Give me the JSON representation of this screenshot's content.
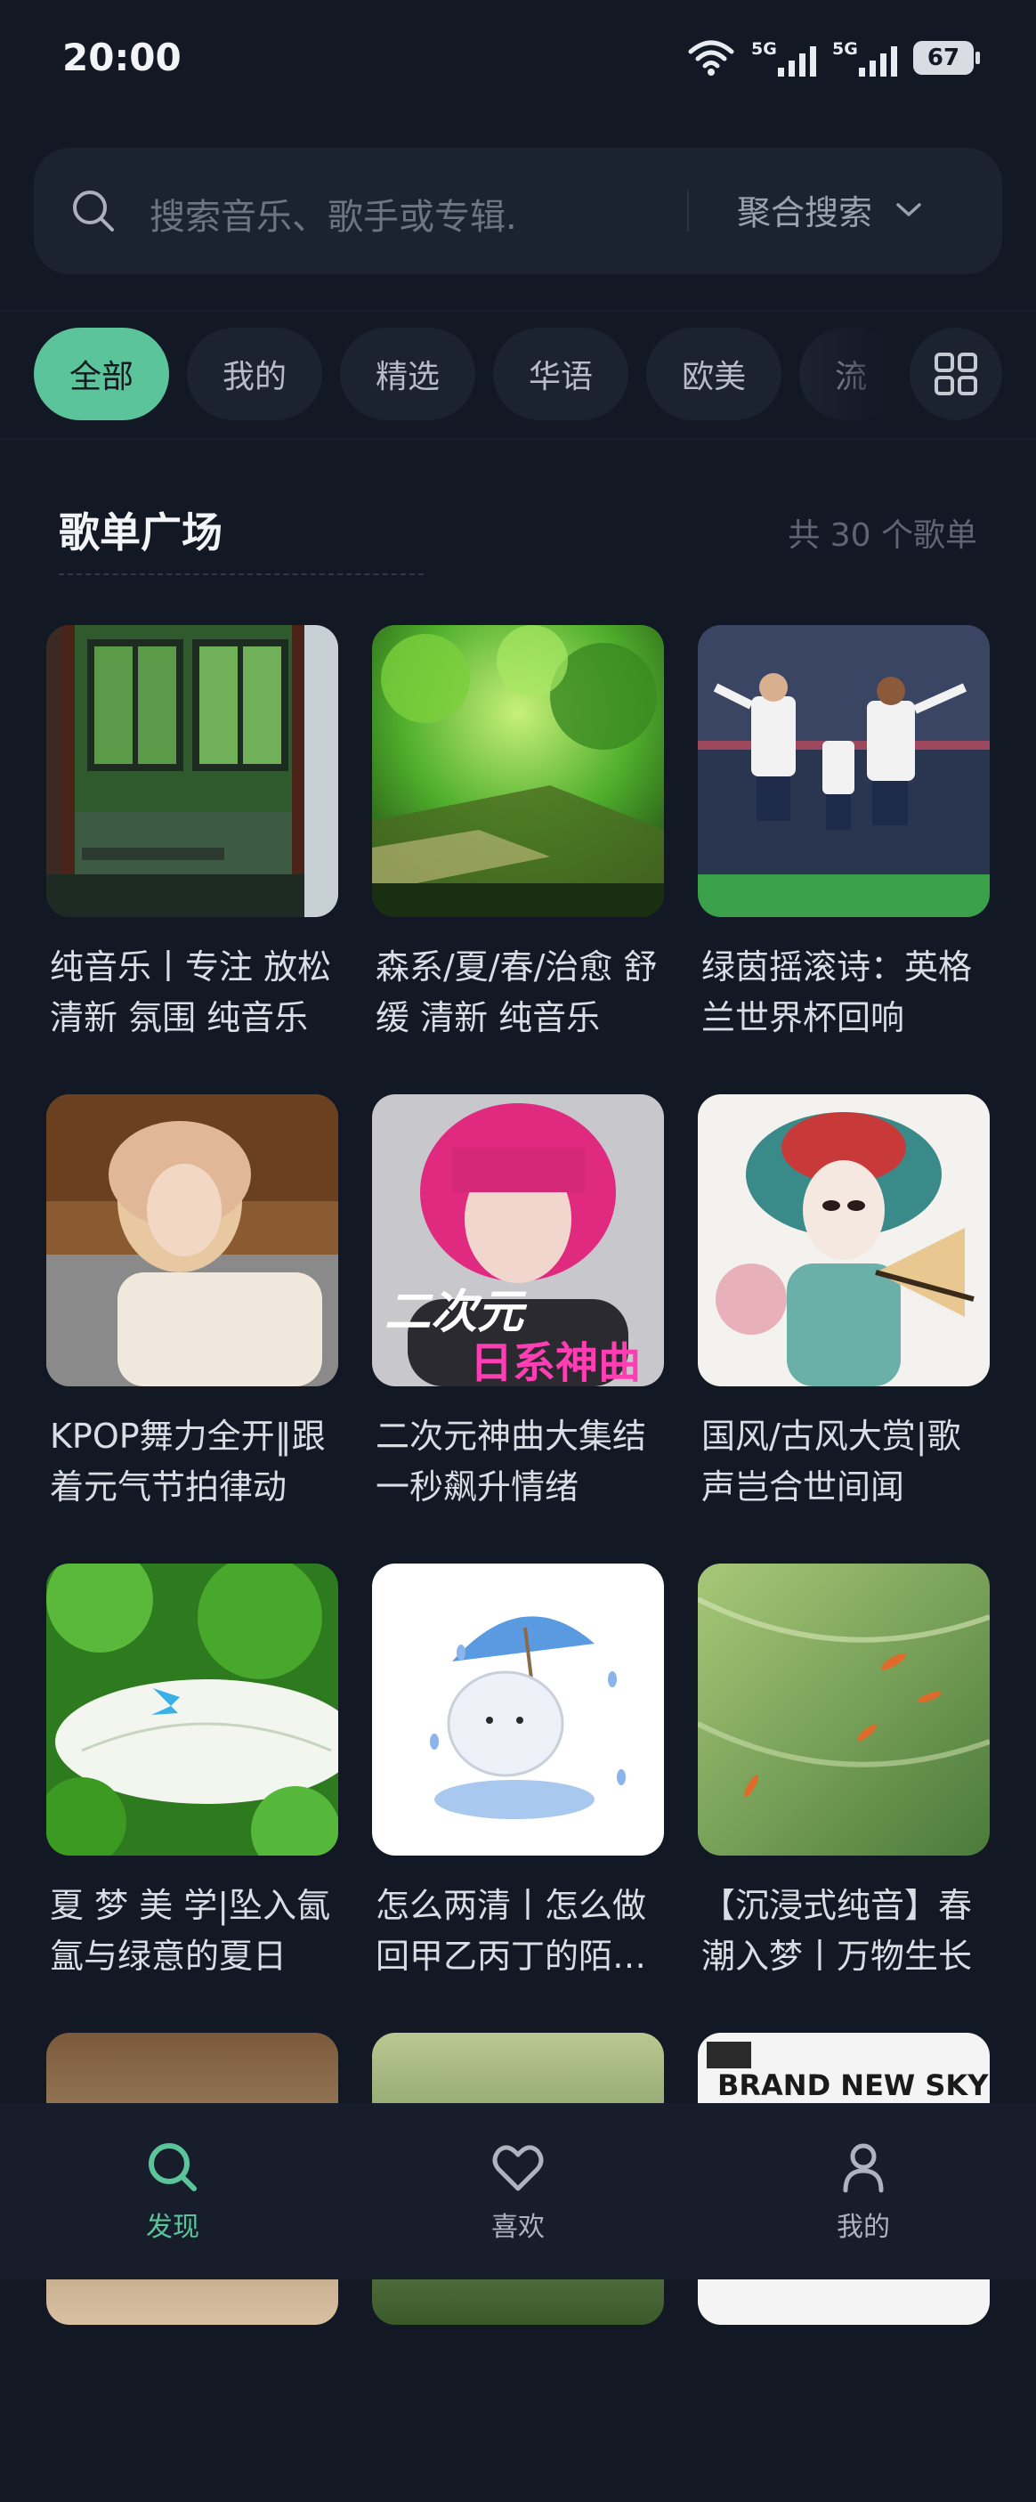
{
  "status_bar": {
    "time": "20:00",
    "battery": "67",
    "network1": "5G",
    "network2": "5G"
  },
  "search": {
    "placeholder": "搜索音乐、歌手或专辑.",
    "mode": "聚合搜索"
  },
  "tabs": [
    "全部",
    "我的",
    "精选",
    "华语",
    "欧美",
    "流"
  ],
  "section": {
    "title": "歌单广场",
    "count": "共 30 个歌单"
  },
  "playlists": [
    {
      "title": "纯音乐丨专注 放松 清新 氛围 纯音乐",
      "cover": "window-green"
    },
    {
      "title": "森系/夏/春/治愈 舒缓 清新 纯音乐",
      "cover": "forest-green"
    },
    {
      "title": "绿茵摇滚诗：英格兰世界杯回响",
      "cover": "football"
    },
    {
      "title": "KPOP舞力全开‖跟着元气节拍律动",
      "cover": "portrait-blonde"
    },
    {
      "title": "二次元神曲大集结 一秒飙升情绪",
      "cover": "anime",
      "overlay1": "二次元",
      "overlay2": "日系神曲"
    },
    {
      "title": "国风/古风大赏|歌声岂合世间闻",
      "cover": "opera"
    },
    {
      "title": "夏 梦 美 学|坠入氤氲与绿意的夏日",
      "cover": "butterfly"
    },
    {
      "title": "怎么两清丨怎么做回甲乙丙丁的陌生人",
      "cover": "umbrella-cat"
    },
    {
      "title": "【沉浸式纯音】春潮入梦丨万物生长",
      "cover": "koi"
    },
    {
      "title": "",
      "cover": "partial-1"
    },
    {
      "title": "",
      "cover": "partial-2"
    },
    {
      "title": "",
      "cover": "partial-3",
      "overlay1": "BRAND NEW SKY"
    }
  ],
  "bottom_nav": [
    {
      "label": "发现",
      "icon": "search-icon",
      "active": true
    },
    {
      "label": "喜欢",
      "icon": "heart-icon",
      "active": false
    },
    {
      "label": "我的",
      "icon": "profile-icon",
      "active": false
    }
  ],
  "colors": {
    "accent": "#5cc49b",
    "background": "#121824",
    "surface": "#1b2230"
  }
}
